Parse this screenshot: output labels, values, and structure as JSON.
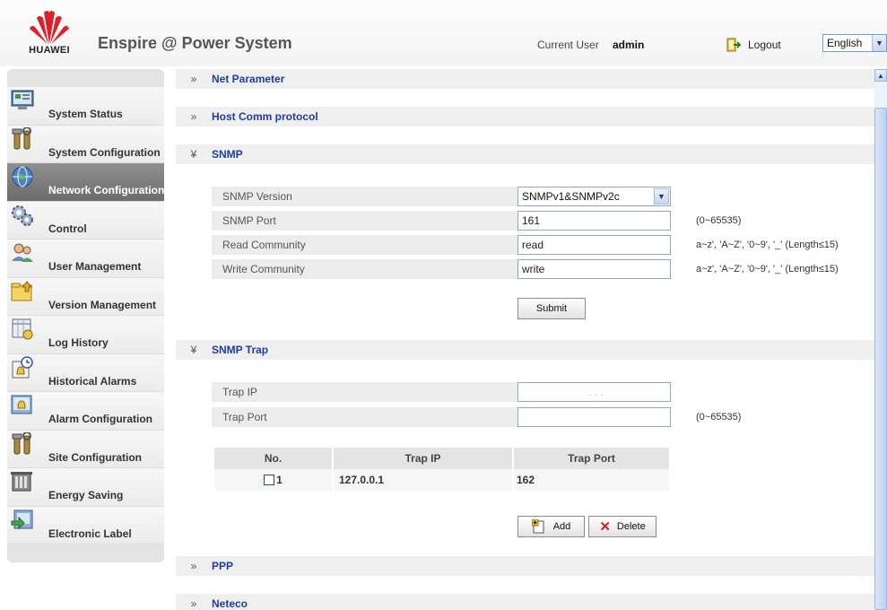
{
  "header": {
    "logo_text": "HUAWEI",
    "app_title": "Enspire @ Power System",
    "current_user_label": "Current User",
    "current_user": "admin",
    "logout_label": "Logout",
    "language": "English"
  },
  "sidebar": {
    "items": [
      {
        "label": "System Status",
        "icon": "monitor-icon"
      },
      {
        "label": "System Configuration",
        "icon": "tools-icon"
      },
      {
        "label": "Network Configuration",
        "icon": "globe-icon",
        "active": true
      },
      {
        "label": "Control",
        "icon": "gears-icon"
      },
      {
        "label": "User Management",
        "icon": "users-icon"
      },
      {
        "label": "Version Management",
        "icon": "folder-upload-icon"
      },
      {
        "label": "Log History",
        "icon": "log-icon"
      },
      {
        "label": "Historical Alarms",
        "icon": "alarm-clock-icon"
      },
      {
        "label": "Alarm Configuration",
        "icon": "alarm-config-icon"
      },
      {
        "label": "Site Configuration",
        "icon": "tools-icon"
      },
      {
        "label": "Energy Saving",
        "icon": "energy-saving-icon"
      },
      {
        "label": "Electronic Label",
        "icon": "electronic-label-icon"
      }
    ]
  },
  "sections": {
    "net_parameter": {
      "title": "Net Parameter",
      "chevron": "»"
    },
    "host_comm": {
      "title": "Host Comm protocol",
      "chevron": "»"
    },
    "snmp": {
      "title": "SNMP",
      "chevron": "¥",
      "version_label": "SNMP Version",
      "version_value": "SNMPv1&SNMPv2c",
      "port_label": "SNMP Port",
      "port_value": "161",
      "port_hint": "(0~65535)",
      "read_label": "Read Community",
      "read_value": "read",
      "read_hint": "a~z', 'A~Z', '0~9', '_' (Length≤15)",
      "write_label": "Write Community",
      "write_value": "write",
      "write_hint": "a~z', 'A~Z', '0~9', '_' (Length≤15)",
      "submit_label": "Submit"
    },
    "snmp_trap": {
      "title": "SNMP Trap",
      "chevron": "¥",
      "ip_label": "Trap IP",
      "ip_dots": ".        .        .",
      "port_label": "Trap Port",
      "port_hint": "(0~65535)",
      "table": {
        "headers": [
          "No.",
          "Trap IP",
          "Trap Port"
        ],
        "rows": [
          {
            "no": "1",
            "ip": "127.0.0.1",
            "port": "162"
          }
        ]
      },
      "add_label": "Add",
      "delete_label": "Delete"
    },
    "ppp": {
      "title": "PPP",
      "chevron": "»"
    },
    "neteco": {
      "title": "Neteco",
      "chevron": "»"
    }
  },
  "colors": {
    "section_title": "#1f3d9e",
    "active_sidebar": "#7a7a7a",
    "huawei_red": "#d9232a"
  }
}
